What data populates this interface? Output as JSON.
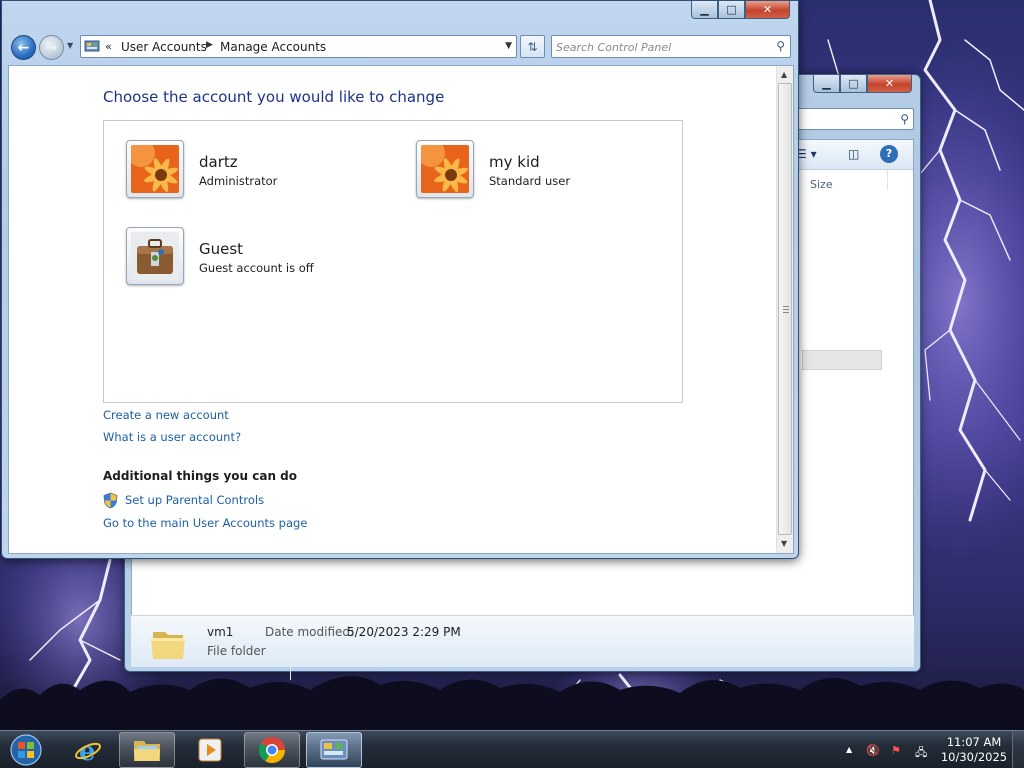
{
  "control_panel": {
    "caption": {
      "minimize": "▁",
      "maximize": "□",
      "close": "✕"
    },
    "breadcrumb": {
      "overflow": "«",
      "items": [
        "User Accounts",
        "Manage Accounts"
      ]
    },
    "search": {
      "placeholder": "Search Control Panel"
    },
    "page_title": "Choose the account you would like to change",
    "accounts": [
      {
        "name": "dartz",
        "type": "Administrator",
        "picture": "flower-picture"
      },
      {
        "name": "my kid",
        "type": "Standard user",
        "picture": "flower-picture"
      },
      {
        "name": "Guest",
        "type": "Guest account is off",
        "picture": "briefcase-picture"
      }
    ],
    "links": {
      "create_account": "Create a new account",
      "what_is": "What is a user account?"
    },
    "additional": {
      "heading": "Additional things you can do",
      "parental_controls": "Set up Parental Controls",
      "main_page": "Go to the main User Accounts page"
    }
  },
  "explorer": {
    "caption": {
      "minimize": "▁",
      "maximize": "□",
      "close": "✕"
    },
    "column_header": "Size",
    "details": {
      "name": "vm1",
      "type": "File folder",
      "modified_label": "Date modified:",
      "modified_value": "5/20/2023 2:29 PM"
    }
  },
  "taskbar": {
    "pinned": [
      "internet-explorer-icon",
      "windows-explorer-icon",
      "media-player-icon",
      "chrome-icon",
      "control-panel-icon"
    ],
    "clock": {
      "time": "11:07 AM",
      "date": "10/30/2025"
    }
  },
  "colors": {
    "link": "#1c5fa8",
    "title": "#1e3287",
    "window_frame": "#b3cbe6",
    "taskbar": "#232c38"
  }
}
